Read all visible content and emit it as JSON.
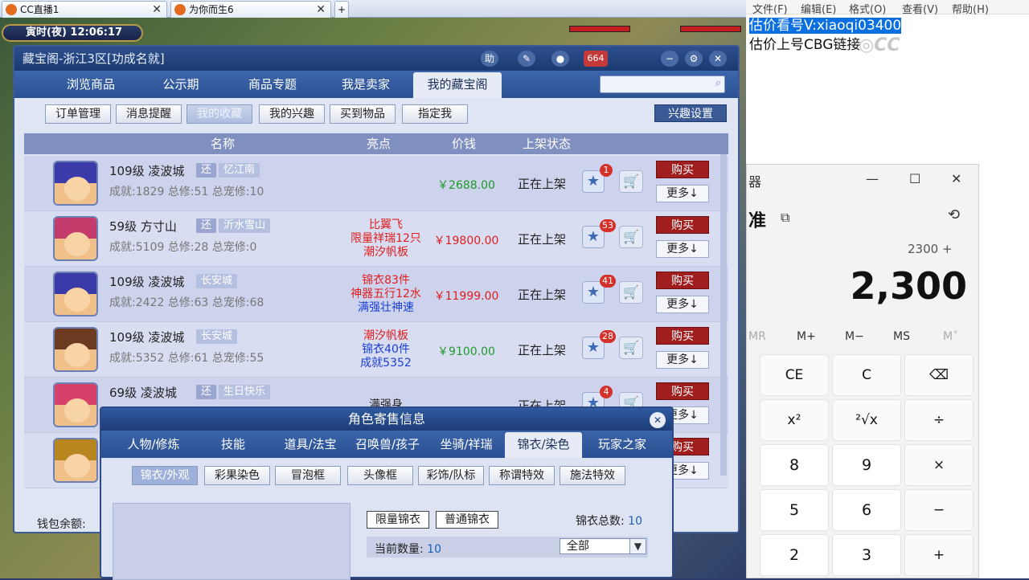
{
  "browser": {
    "tabs": [
      {
        "label": "CC直播1"
      },
      {
        "label": "为你而生6"
      }
    ],
    "new_tab": "+"
  },
  "hud": {
    "time": "寅时(夜) 12:06:17"
  },
  "window": {
    "title": "藏宝阁-浙江3区[功成名就]",
    "title_buttons": [
      "助",
      "✎",
      "●",
      "664",
      "✕"
    ],
    "chat_count": "664",
    "nav_tabs": [
      "浏览商品",
      "公示期",
      "商品专题",
      "我是卖家",
      "我的藏宝阁"
    ],
    "active_nav": "我的藏宝阁",
    "sub_tabs": [
      "订单管理",
      "消息提醒",
      "我的收藏",
      "我的兴趣",
      "买到物品",
      "指定我"
    ],
    "active_sub": "我的收藏",
    "interest_button": "兴趣设置",
    "columns": {
      "name": "名称",
      "highlight": "亮点",
      "price": "价钱",
      "status": "上架状态"
    },
    "rows": [
      {
        "line1": "109级 凌波城",
        "tag1": "还",
        "tag2": "忆江南",
        "line2": "成就:1829 总修:51 总宠修:10",
        "highlights": [],
        "price": "￥2688.00",
        "price_color": "#1d9a2a",
        "status": "正在上架",
        "favs": "1",
        "buy": "购买",
        "more": "更多↓"
      },
      {
        "line1": "59级 方寸山",
        "tag1": "还",
        "tag2": "沂水雪山",
        "line2": "成就:5109 总修:28 总宠修:0",
        "highlights": [
          {
            "text": "比翼飞",
            "color": "#e01e1e"
          },
          {
            "text": "限量祥瑞12只",
            "color": "#e01e1e"
          },
          {
            "text": "潮汐帆板",
            "color": "#e01e1e"
          }
        ],
        "price": "￥19800.00",
        "price_color": "#e01e1e",
        "status": "正在上架",
        "favs": "53",
        "buy": "购买",
        "more": "更多↓"
      },
      {
        "line1": "109级 凌波城",
        "tag1": "",
        "tag2": "长安城",
        "line2": "成就:2422 总修:63 总宠修:68",
        "highlights": [
          {
            "text": "锦衣83件",
            "color": "#e01e1e"
          },
          {
            "text": "神器五行12水",
            "color": "#e01e1e"
          },
          {
            "text": "满强壮神速",
            "color": "#1a3fd6"
          }
        ],
        "price": "￥11999.00",
        "price_color": "#e01e1e",
        "status": "正在上架",
        "favs": "41",
        "buy": "购买",
        "more": "更多↓"
      },
      {
        "line1": "109级 凌波城",
        "tag1": "",
        "tag2": "长安城",
        "line2": "成就:5352 总修:61 总宠修:55",
        "highlights": [
          {
            "text": "潮汐帆板",
            "color": "#e01e1e"
          },
          {
            "text": "锦衣40件",
            "color": "#1a3fd6"
          },
          {
            "text": "成就5352",
            "color": "#1a3fd6"
          }
        ],
        "price": "￥9100.00",
        "price_color": "#1d9a2a",
        "status": "正在上架",
        "favs": "28",
        "buy": "购买",
        "more": "更多↓"
      },
      {
        "line1": "69级 凌波城",
        "tag1": "还",
        "tag2": "生日快乐",
        "line2": "",
        "highlights": [
          {
            "text": "满强身",
            "color": "#222222"
          }
        ],
        "price": "",
        "price_color": "#1d9a2a",
        "status": "正在上架",
        "favs": "4",
        "buy": "购买",
        "more": "更多↓"
      },
      {
        "line1": "",
        "tag1": "",
        "tag2": "",
        "line2": "",
        "highlights": [],
        "price": "",
        "price_color": "#1d9a2a",
        "status": "",
        "favs": "",
        "buy": "购买",
        "more": "更多↓"
      }
    ],
    "wallet_label": "钱包余额:"
  },
  "popup": {
    "title": "角色寄售信息",
    "tabs": [
      "人物/修炼",
      "技能",
      "道具/法宝",
      "召唤兽/孩子",
      "坐骑/祥瑞",
      "锦衣/染色",
      "玩家之家"
    ],
    "active_tab": "锦衣/染色",
    "sub_tabs": [
      "锦衣/外观",
      "彩果染色",
      "冒泡框",
      "头像框",
      "彩饰/队标",
      "称谓特效",
      "施法特效"
    ],
    "active_sub": "锦衣/外观",
    "limited_btn": "限量锦衣",
    "normal_btn": "普通锦衣",
    "total_label": "锦衣总数:",
    "total_value": "10",
    "current_label": "当前数量:",
    "current_value": "10",
    "filter_value": "全部"
  },
  "notepad": {
    "menu": [
      "文件(F)",
      "编辑(E)",
      "格式(O)",
      "查看(V)",
      "帮助(H)"
    ],
    "line1": "估价看号V:xiaoqi03400",
    "line2": "估价上号CBG链接"
  },
  "calculator": {
    "title": "器",
    "mode": "准",
    "expression": "2300 +",
    "result": "2,300",
    "memory": [
      "MR",
      "M+",
      "M−",
      "MS",
      "M˅"
    ],
    "keys": [
      "CE",
      "C",
      "⌫",
      "x²",
      "²√x",
      "÷",
      "8",
      "9",
      "×",
      "5",
      "6",
      "−",
      "2",
      "3",
      "+"
    ]
  }
}
